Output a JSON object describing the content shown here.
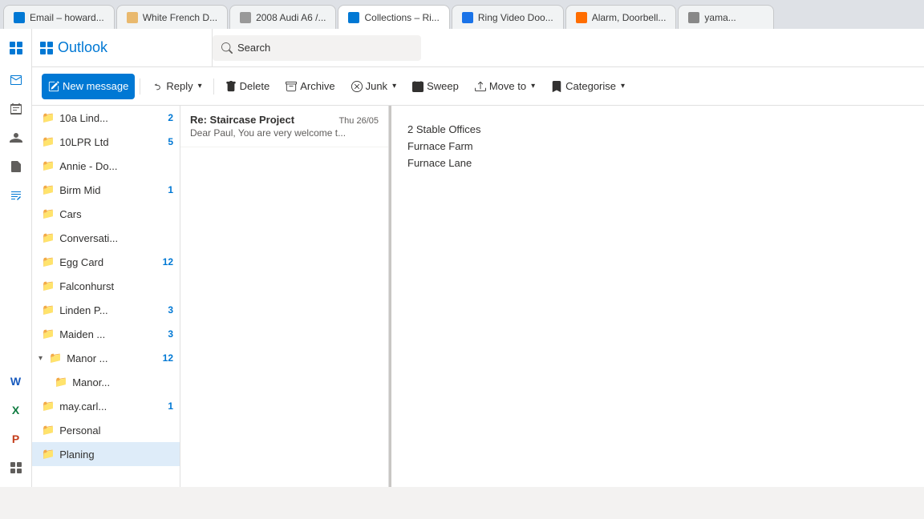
{
  "browser": {
    "tabs": [
      {
        "id": "tab1",
        "label": "Email – howard...",
        "active": false
      },
      {
        "id": "tab2",
        "label": "White French D...",
        "active": false
      },
      {
        "id": "tab3",
        "label": "2008 Audi A6 /...",
        "active": false
      },
      {
        "id": "tab4",
        "label": "Collections – Ri...",
        "active": true
      },
      {
        "id": "tab5",
        "label": "Ring Video Doo...",
        "active": false
      },
      {
        "id": "tab6",
        "label": "Alarm, Doorbell...",
        "active": false
      },
      {
        "id": "tab7",
        "label": "yama...",
        "active": false
      }
    ]
  },
  "search": {
    "placeholder": "Search",
    "value": "Search"
  },
  "toolbar": {
    "new_message_label": "New message",
    "reply_label": "Reply",
    "delete_label": "Delete",
    "archive_label": "Archive",
    "junk_label": "Junk",
    "sweep_label": "Sweep",
    "move_to_label": "Move to",
    "categorise_label": "Categorise"
  },
  "iconbar": {
    "items": [
      {
        "name": "mail-icon",
        "icon": "✉",
        "active": true
      },
      {
        "name": "calendar-icon",
        "icon": "📅",
        "active": false
      },
      {
        "name": "people-icon",
        "icon": "👥",
        "active": false
      },
      {
        "name": "files-icon",
        "icon": "📎",
        "active": false
      },
      {
        "name": "todo-icon",
        "icon": "✔",
        "active": false
      },
      {
        "name": "word-icon",
        "icon": "W",
        "active": false
      },
      {
        "name": "excel-icon",
        "icon": "X",
        "active": false
      },
      {
        "name": "powerpoint-icon",
        "icon": "P",
        "active": false
      },
      {
        "name": "apps-icon",
        "icon": "⊞",
        "active": false
      }
    ]
  },
  "sidebar": {
    "folders": [
      {
        "name": "10a Lind...",
        "badge": "2",
        "indented": false,
        "collapsed": false
      },
      {
        "name": "10LPR Ltd",
        "badge": "5",
        "indented": false,
        "collapsed": false
      },
      {
        "name": "Annie - Do...",
        "badge": "",
        "indented": false,
        "collapsed": false
      },
      {
        "name": "Birm Mid",
        "badge": "1",
        "indented": false,
        "collapsed": false
      },
      {
        "name": "Cars",
        "badge": "",
        "indented": false,
        "collapsed": false
      },
      {
        "name": "Conversati...",
        "badge": "",
        "indented": false,
        "collapsed": false
      },
      {
        "name": "Egg Card",
        "badge": "12",
        "indented": false,
        "collapsed": false
      },
      {
        "name": "Falconhurst",
        "badge": "",
        "indented": false,
        "collapsed": false
      },
      {
        "name": "Linden P...",
        "badge": "3",
        "indented": false,
        "collapsed": false
      },
      {
        "name": "Maiden ...",
        "badge": "3",
        "indented": false,
        "collapsed": false
      },
      {
        "name": "Manor ...",
        "badge": "12",
        "indented": false,
        "collapsed": true,
        "expanded": true
      },
      {
        "name": "Manor...",
        "badge": "",
        "indented": true,
        "collapsed": false
      },
      {
        "name": "may.carl...",
        "badge": "1",
        "indented": false,
        "collapsed": false
      },
      {
        "name": "Personal",
        "badge": "",
        "indented": false,
        "collapsed": false
      },
      {
        "name": "Planing",
        "badge": "",
        "indented": false,
        "collapsed": false,
        "active": true
      }
    ]
  },
  "emailList": {
    "items": [
      {
        "subject": "Re: Staircase Project",
        "preview": "Dear Paul, You are very welcome t...",
        "date": "Thu 26/05"
      }
    ]
  },
  "readingPane": {
    "address_line1": "2 Stable Offices",
    "address_line2": "Furnace Farm",
    "address_line3": "Furnace Lane"
  },
  "colors": {
    "accent": "#0078d4",
    "bg": "#ffffff",
    "sidebar_bg": "#ffffff",
    "selected_bg": "#deecf9",
    "hover_bg": "#f3f2f1"
  }
}
